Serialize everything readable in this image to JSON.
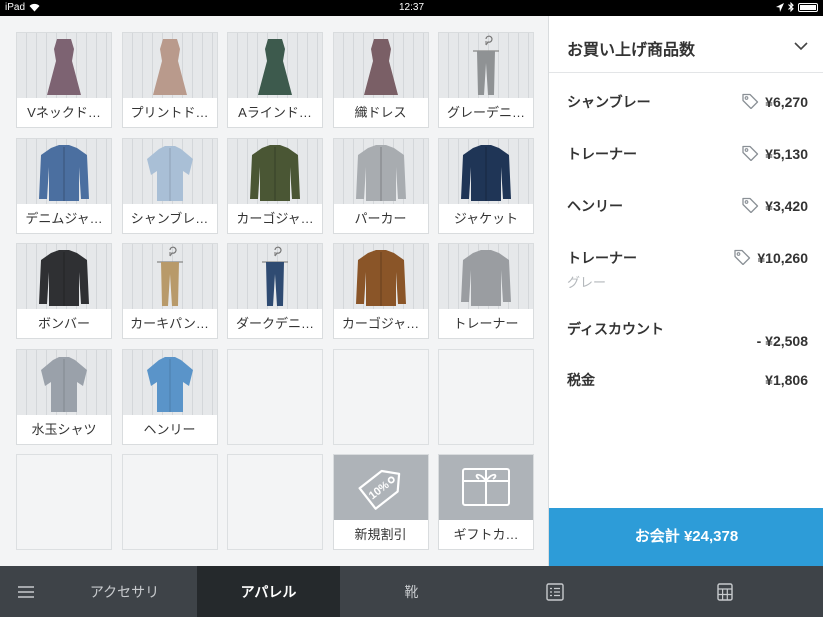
{
  "status_bar": {
    "device": "iPad",
    "time": "12:37"
  },
  "products": [
    {
      "label": "Vネックド…",
      "icon": "dress-icon",
      "color": "#7d6372"
    },
    {
      "label": "プリントド…",
      "icon": "dress-icon",
      "color": "#b99a8c"
    },
    {
      "label": "Aラインド…",
      "icon": "dress-icon",
      "color": "#3d5a4d"
    },
    {
      "label": "織ドレス",
      "icon": "dress-icon",
      "color": "#7a5f66"
    },
    {
      "label": "グレーデニ…",
      "icon": "pants-on-hanger-icon",
      "color": "#8f9294"
    },
    {
      "label": "デニムジャ…",
      "icon": "jacket-icon",
      "color": "#4b6fa0"
    },
    {
      "label": "シャンブレ…",
      "icon": "shirt-icon",
      "color": "#a9bfd6"
    },
    {
      "label": "カーゴジャ…",
      "icon": "jacket-icon",
      "color": "#4a5634"
    },
    {
      "label": "パーカー",
      "icon": "jacket-icon",
      "color": "#a8acb0"
    },
    {
      "label": "ジャケット",
      "icon": "jacket-icon",
      "color": "#1f3556"
    },
    {
      "label": "ボンバー",
      "icon": "jacket-icon",
      "color": "#2f3033"
    },
    {
      "label": "カーキパン…",
      "icon": "pants-on-hanger-icon",
      "color": "#b89a6a"
    },
    {
      "label": "ダークデニ…",
      "icon": "pants-on-hanger-icon",
      "color": "#2f4b72"
    },
    {
      "label": "カーゴジャ…",
      "icon": "jacket-icon",
      "color": "#8a5528"
    },
    {
      "label": "トレーナー",
      "icon": "sweater-icon",
      "color": "#9a9da1"
    },
    {
      "label": "水玉シャツ",
      "icon": "shirt-icon",
      "color": "#9aa1aa"
    },
    {
      "label": "ヘンリー",
      "icon": "shirt-icon",
      "color": "#5a94c9"
    }
  ],
  "specials": [
    {
      "label": "新規割引",
      "icon": "discount-tag-icon",
      "tag_text": "10%"
    },
    {
      "label": "ギフトカ…",
      "icon": "gift-card-icon"
    }
  ],
  "cart": {
    "title": "お買い上げ商品数",
    "items": [
      {
        "name": "シャンブレー",
        "price": "¥6,270",
        "tagged": true
      },
      {
        "name": "トレーナー",
        "price": "¥5,130",
        "tagged": true
      },
      {
        "name": "ヘンリー",
        "price": "¥3,420",
        "tagged": true
      },
      {
        "name": "トレーナー",
        "sub": "グレー",
        "price": "¥10,260",
        "tagged": true
      },
      {
        "name": "ディスカウント",
        "price": "- ¥2,508",
        "tagged": false
      },
      {
        "name": "税金",
        "price": "¥1,806",
        "tagged": false
      }
    ],
    "checkout_label": "お会計 ¥24,378"
  },
  "tabs": [
    {
      "label": "",
      "icon": "menu-icon"
    },
    {
      "label": "アクセサリ"
    },
    {
      "label": "アパレル",
      "active": true
    },
    {
      "label": "靴"
    },
    {
      "label": "",
      "icon": "list-icon"
    },
    {
      "label": "",
      "icon": "calculator-icon"
    }
  ]
}
